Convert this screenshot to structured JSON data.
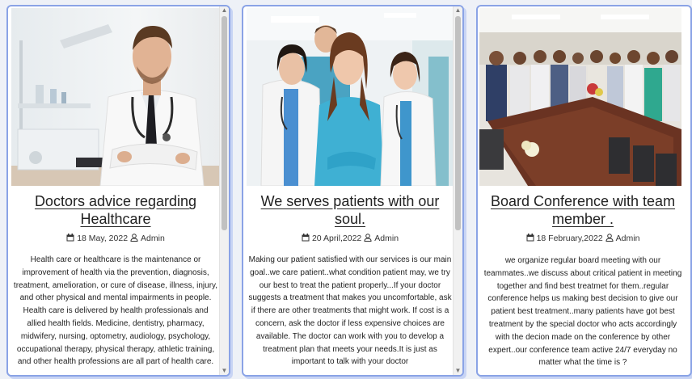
{
  "cards": [
    {
      "title": "Doctors advice regarding Healthcare",
      "date": "18 May, 2022",
      "author": "Admin",
      "text": "Health care or healthcare is the maintenance or improvement of health via the prevention, diagnosis, treatment, amelioration, or cure of disease, illness, injury, and other physical and mental impairments in people. Health care is delivered by health professionals and allied health fields. Medicine, dentistry, pharmacy, midwifery, nursing, optometry, audiology, psychology, occupational therapy, physical therapy, athletic training, and other health professions are all part of health care."
    },
    {
      "title": "We serves patients with our soul.",
      "date": "20 April,2022",
      "author": "Admin",
      "text": "Making our patient satisfied with our services is our main goal..we care patient..what condition patient may, we try our best to treat the patient properly...If your doctor suggests a treatment that makes you uncomfortable, ask if there are other treatments that might work. If cost is a concern, ask the doctor if less expensive choices are available. The doctor can work with you to develop a treatment plan that meets your needs.It is just as important to talk with your doctor"
    },
    {
      "title": "Board Conference with team member .",
      "date": "18 February,2022",
      "author": "Admin",
      "text": "we organize regular board meeting with our teammates..we discuss about critical patient in meeting together and find best treatmet for them..regular conference helps us making best decision to give our patient best treatment..many patients have got best treatment by the special doctor who acts accordingly with the decion made on the conference by other expert..our conference team active 24/7 everyday no matter what the time is ?"
    }
  ],
  "icons": {
    "date": "calendar-icon",
    "author": "user-icon"
  },
  "colors": {
    "card_border": "#8aa3e6",
    "text": "#222222",
    "background": "#eef1f7"
  }
}
